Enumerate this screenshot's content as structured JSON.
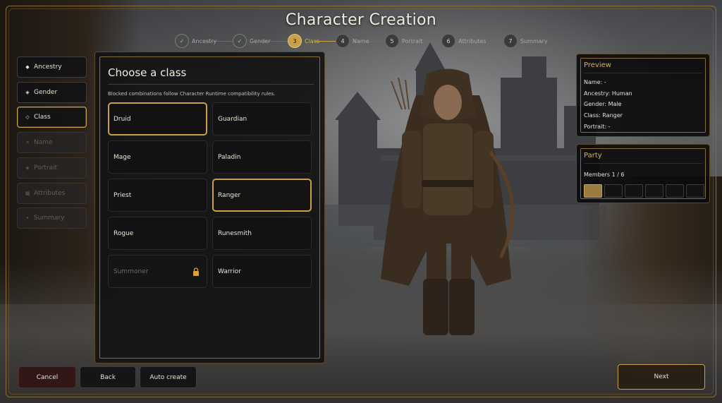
{
  "title": "Character Creation",
  "stepper": [
    {
      "num": "✓",
      "label": "Ancestry",
      "state": "done"
    },
    {
      "num": "✓",
      "label": "Gender",
      "state": "done"
    },
    {
      "num": "3",
      "label": "Class",
      "state": "active"
    },
    {
      "num": "4",
      "label": "Name",
      "state": "todo"
    },
    {
      "num": "5",
      "label": "Portrait",
      "state": "todo"
    },
    {
      "num": "6",
      "label": "Attributes",
      "state": "todo"
    },
    {
      "num": "7",
      "label": "Summary",
      "state": "todo"
    }
  ],
  "nav": [
    {
      "label": "Ancestry",
      "icon": "diamond-icon",
      "glyph": "◆",
      "state": "done"
    },
    {
      "label": "Gender",
      "icon": "diamond-dot-icon",
      "glyph": "◈",
      "state": "done"
    },
    {
      "label": "Class",
      "icon": "diamond-outline-icon",
      "glyph": "◇",
      "state": "active"
    },
    {
      "label": "Name",
      "icon": "cross-icon",
      "glyph": "✕",
      "state": "disabled"
    },
    {
      "label": "Portrait",
      "icon": "diamond-dot-icon",
      "glyph": "◈",
      "state": "disabled"
    },
    {
      "label": "Attributes",
      "icon": "grid-icon",
      "glyph": "▦",
      "state": "disabled"
    },
    {
      "label": "Summary",
      "icon": "dot-icon",
      "glyph": "•",
      "state": "disabled"
    }
  ],
  "panel": {
    "heading": "Choose a class",
    "hint": "Blocked combinations follow Character Runtime compatibility rules.",
    "classes": [
      {
        "name": "Druid",
        "state": "selected"
      },
      {
        "name": "Guardian",
        "state": "normal"
      },
      {
        "name": "Mage",
        "state": "normal"
      },
      {
        "name": "Paladin",
        "state": "normal"
      },
      {
        "name": "Priest",
        "state": "normal"
      },
      {
        "name": "Ranger",
        "state": "hovered"
      },
      {
        "name": "Rogue",
        "state": "normal"
      },
      {
        "name": "Runesmith",
        "state": "normal"
      },
      {
        "name": "Summoner",
        "state": "locked"
      },
      {
        "name": "Warrior",
        "state": "normal"
      }
    ]
  },
  "preview": {
    "title": "Preview",
    "name": "Name: -",
    "ancestry": "Ancestry: Human",
    "gender": "Gender: Male",
    "class": "Class: Ranger",
    "portrait": "Portrait: -"
  },
  "party": {
    "title": "Party",
    "members": "Members 1 / 6",
    "filled": 1,
    "total": 6
  },
  "buttons": {
    "cancel": "Cancel",
    "back": "Back",
    "auto": "Auto create",
    "next": "Next"
  },
  "colors": {
    "accent": "#c9a14a",
    "lock": "#e0a23a"
  }
}
